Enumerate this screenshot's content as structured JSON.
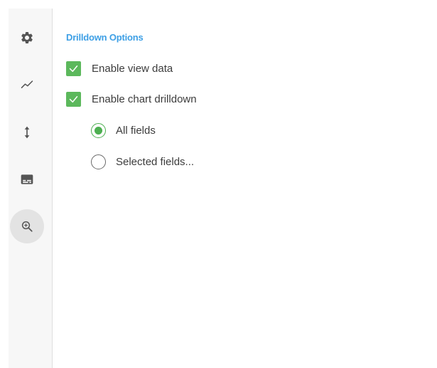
{
  "sidebar": {
    "items": [
      {
        "icon": "gear-icon",
        "active": false
      },
      {
        "icon": "line-chart-icon",
        "active": false
      },
      {
        "icon": "vertical-arrows-icon",
        "active": false
      },
      {
        "icon": "subtitles-icon",
        "active": false
      },
      {
        "icon": "zoom-in-icon",
        "active": true
      }
    ]
  },
  "drilldown": {
    "title": "Drilldown Options",
    "enable_view_data": {
      "label": "Enable view data",
      "checked": true
    },
    "enable_chart_drilldown": {
      "label": "Enable chart drilldown",
      "checked": true
    },
    "fields_options": [
      {
        "label": "All fields",
        "selected": true
      },
      {
        "label": "Selected fields...",
        "selected": false
      }
    ]
  },
  "colors": {
    "accent_blue": "#3d9fe5",
    "checkbox_green": "#5cb85c",
    "radio_green": "#4caf50",
    "icon_gray": "#555555"
  }
}
